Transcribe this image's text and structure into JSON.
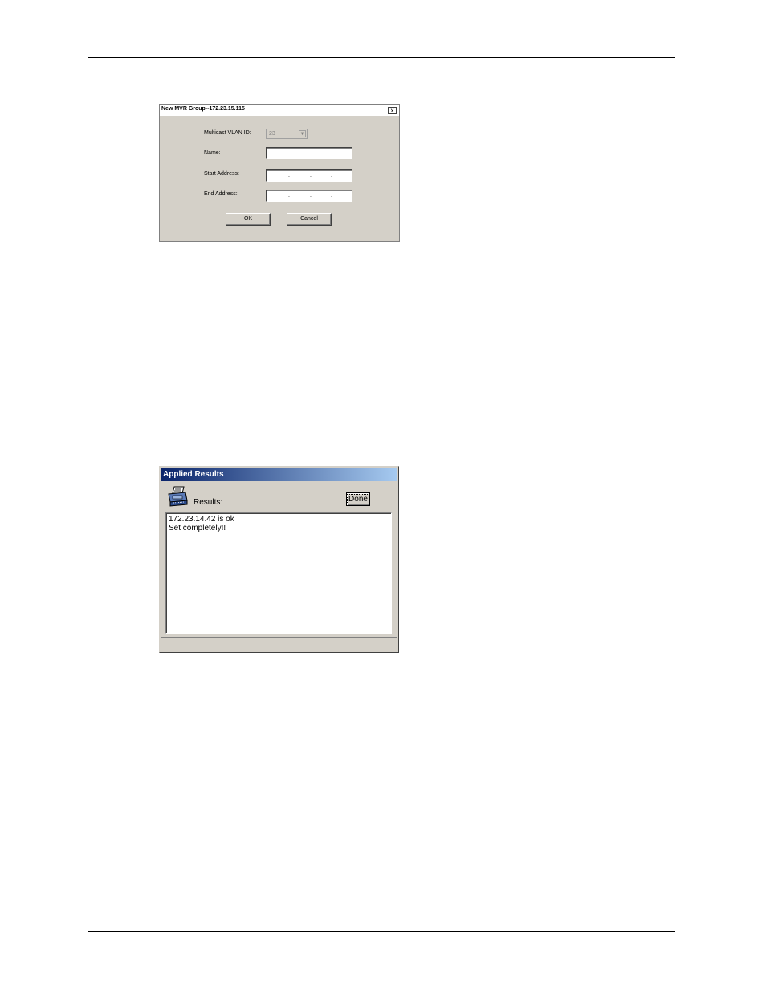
{
  "page": {
    "has_top_rule": true,
    "has_bottom_rule": true
  },
  "mvr_dialog": {
    "title": "New MVR Group--172.23.15.115",
    "close_glyph": "x",
    "vlan_label": "Multicast VLAN ID:",
    "vlan_value": "23",
    "name_label": "Name:",
    "name_value": "",
    "start_label": "Start Address:",
    "end_label": "End Address:",
    "ok_label": "OK",
    "cancel_label": "Cancel"
  },
  "results_dialog": {
    "title": "Applied Results",
    "icon": "printer-icon",
    "results_label": "Results:",
    "done_label": "Done",
    "lines": [
      "172.23.14.42 is ok",
      "Set completely!!"
    ]
  }
}
